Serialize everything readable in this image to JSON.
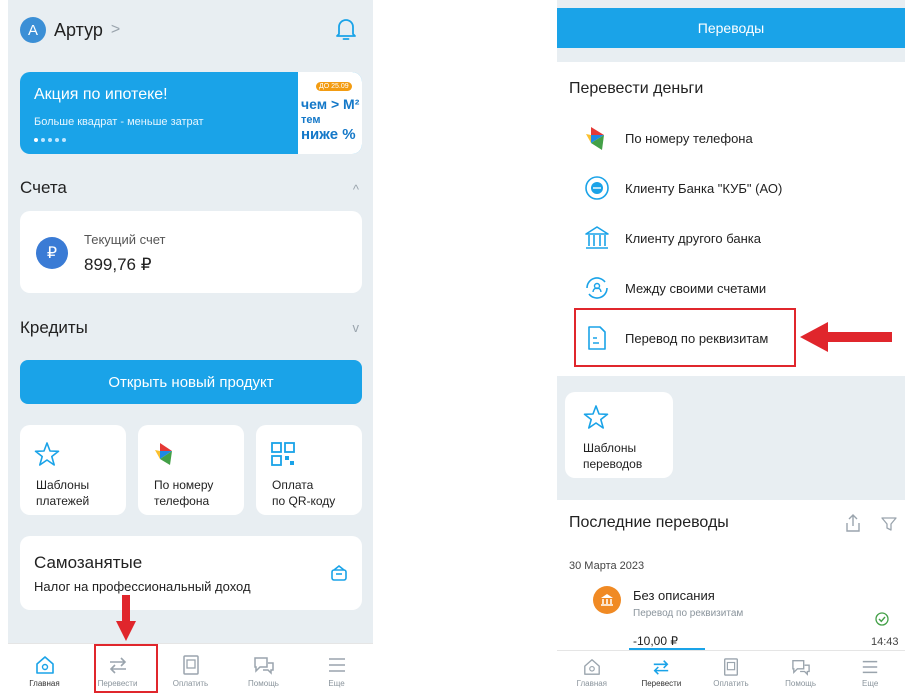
{
  "left": {
    "header": {
      "avatar_letter": "А",
      "user_name": "Артур",
      "chevron": ">"
    },
    "banner": {
      "title": "Акция по ипотеке!",
      "subtitle": "Больше квадрат - меньше затрат",
      "art_badge": "ДО 25.09",
      "art_line1": "чем > М²",
      "art_line2": "тем",
      "art_line3": "ниже %"
    },
    "accounts": {
      "title": "Счета",
      "chevron": "^",
      "item_name": "Текущий счет",
      "item_amount": "899,76 ₽",
      "currency_symbol": "₽"
    },
    "credits": {
      "title": "Кредиты",
      "chevron": "v"
    },
    "open_button": "Открыть новый продукт",
    "tiles": [
      {
        "label": "Шаблоны\nплатежей",
        "icon": "star-icon"
      },
      {
        "label": "По номеру\nтелефона",
        "icon": "phone-transfer-icon"
      },
      {
        "label": "Оплата\nпо QR-коду",
        "icon": "qr-code-icon"
      }
    ],
    "self_employed": {
      "title": "Самозанятые",
      "subtitle": "Налог на профессиональный доход"
    },
    "tabbar": [
      {
        "label": "Главная",
        "icon": "home-icon"
      },
      {
        "label": "Перевести",
        "icon": "transfer-arrows-icon"
      },
      {
        "label": "Оплатить",
        "icon": "pay-icon"
      },
      {
        "label": "Помощь",
        "icon": "help-chat-icon"
      },
      {
        "label": "Еще",
        "icon": "menu-icon"
      }
    ]
  },
  "right": {
    "header_title": "Переводы",
    "panel_title": "Перевести деньги",
    "items": [
      {
        "label": "По номеру телефона",
        "icon": "phone-transfer-icon"
      },
      {
        "label": "Клиенту Банка \"КУБ\" (АО)",
        "icon": "bank-client-icon"
      },
      {
        "label": "Клиенту другого банка",
        "icon": "other-bank-icon"
      },
      {
        "label": "Между своими счетами",
        "icon": "between-accounts-icon"
      },
      {
        "label": "Перевод по реквизитам",
        "icon": "document-icon"
      }
    ],
    "templates": {
      "label": "Шаблоны\nпереводов"
    },
    "recent": {
      "title": "Последние переводы",
      "date": "30 Марта 2023",
      "tx_title": "Без описания",
      "tx_subtitle": "Перевод по реквизитам",
      "tx_amount": "-10,00 ₽",
      "tx_time": "14:43"
    },
    "tabbar": [
      {
        "label": "Главная",
        "icon": "home-icon"
      },
      {
        "label": "Перевести",
        "icon": "transfer-arrows-icon"
      },
      {
        "label": "Оплатить",
        "icon": "pay-icon"
      },
      {
        "label": "Помощь",
        "icon": "help-chat-icon"
      },
      {
        "label": "Еще",
        "icon": "menu-icon"
      }
    ]
  },
  "colors": {
    "brand_blue": "#1aa3e8",
    "highlight_red": "#e0262c",
    "background": "#e8eef2"
  }
}
